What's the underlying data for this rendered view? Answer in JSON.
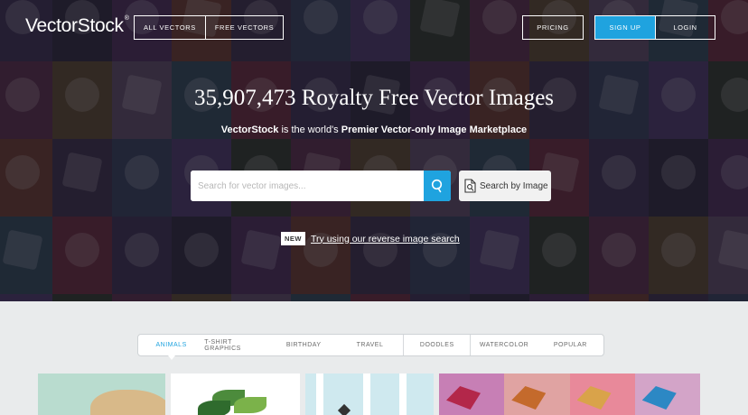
{
  "nav": {
    "logo_text": "VectorStock",
    "logo_mark": "®",
    "vectors_buttons": [
      "ALL VECTORS",
      "FREE VECTORS"
    ],
    "pricing_label": "PRICING",
    "signup_label": "SIGN UP",
    "login_label": "LOGIN"
  },
  "hero": {
    "headline": "35,907,473 Royalty Free Vector Images",
    "subline_brand": "VectorStock",
    "subline_mid": " is the world's ",
    "subline_tail": "Premier Vector-only Image Marketplace",
    "search": {
      "placeholder": "Search for vector images...",
      "button_icon": "search-icon"
    },
    "search_by_image_label": "Search by Image",
    "search_by_image_icon": "image-file-icon",
    "new_badge": "NEW",
    "reverse_link": "Try using our reverse image search"
  },
  "categories": {
    "tabs": [
      "ANIMALS",
      "T-SHIRT GRAPHICS",
      "BIRTHDAY",
      "TRAVEL",
      "DOODLES",
      "WATERCOLOR",
      "POPULAR"
    ],
    "active_index": 0
  },
  "colors": {
    "accent": "#1fa3df",
    "hero_overlay": "#14121c",
    "page_bg": "#e9ebec",
    "mosaic": [
      "#3b3152",
      "#5a2f4a",
      "#6b3d2e",
      "#2f4a5a",
      "#4a3a6b",
      "#2d2a3d",
      "#5b4a2e",
      "#39304a",
      "#6a2c3c",
      "#2f3b2c",
      "#4b2f5a",
      "#5d4c66",
      "#33405c"
    ]
  }
}
